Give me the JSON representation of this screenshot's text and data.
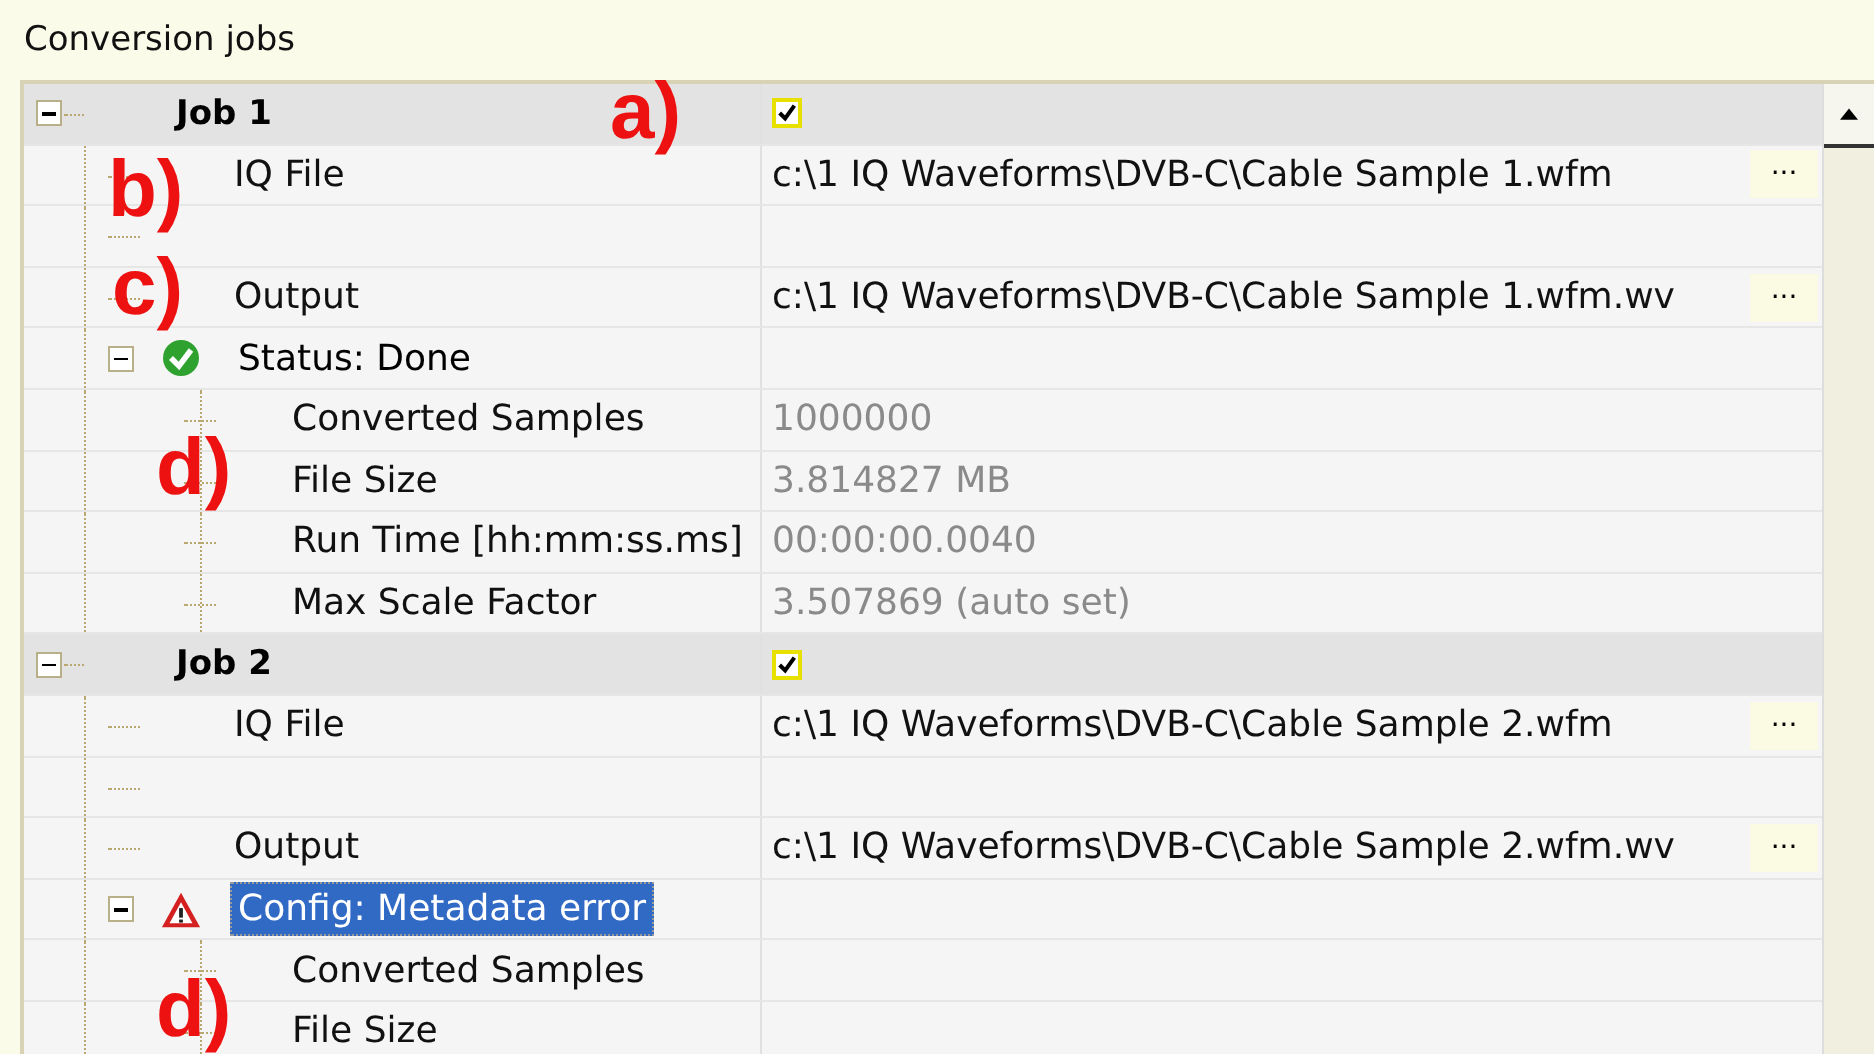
{
  "title": "Conversion jobs",
  "jobs": [
    {
      "name": "Job 1",
      "checked": true,
      "rows": [
        {
          "kind": "file",
          "label": "IQ File",
          "value": "c:\\1 IQ Waveforms\\DVB-C\\Cable Sample 1.wfm",
          "button": "···"
        },
        {
          "kind": "blank"
        },
        {
          "kind": "file",
          "label": "Output",
          "value": "c:\\1 IQ Waveforms\\DVB-C\\Cable Sample 1.wfm.wv",
          "button": "···"
        }
      ],
      "status": {
        "kind": "done",
        "label": "Status: Done",
        "selected": false,
        "rows": [
          {
            "label": "Converted Samples",
            "value": "1000000"
          },
          {
            "label": "File Size",
            "value": "3.814827 MB"
          },
          {
            "label": "Run Time [hh:mm:ss.ms]",
            "value": "00:00:00.0040"
          },
          {
            "label": "Max Scale Factor",
            "value": "3.507869 (auto set)"
          }
        ]
      }
    },
    {
      "name": "Job 2",
      "checked": true,
      "rows": [
        {
          "kind": "file",
          "label": "IQ File",
          "value": "c:\\1 IQ Waveforms\\DVB-C\\Cable Sample 2.wfm",
          "button": "···"
        },
        {
          "kind": "blank"
        },
        {
          "kind": "file",
          "label": "Output",
          "value": "c:\\1 IQ Waveforms\\DVB-C\\Cable Sample 2.wfm.wv",
          "button": "···"
        }
      ],
      "status": {
        "kind": "error",
        "label": "Config: Metadata error",
        "selected": true,
        "rows": [
          {
            "label": "Converted Samples"
          },
          {
            "label": "File Size"
          }
        ]
      }
    }
  ],
  "annotations": [
    {
      "label": "a)"
    },
    {
      "label": "b)"
    },
    {
      "label": "c)"
    },
    {
      "label": "d)"
    },
    {
      "label": "d)"
    }
  ]
}
